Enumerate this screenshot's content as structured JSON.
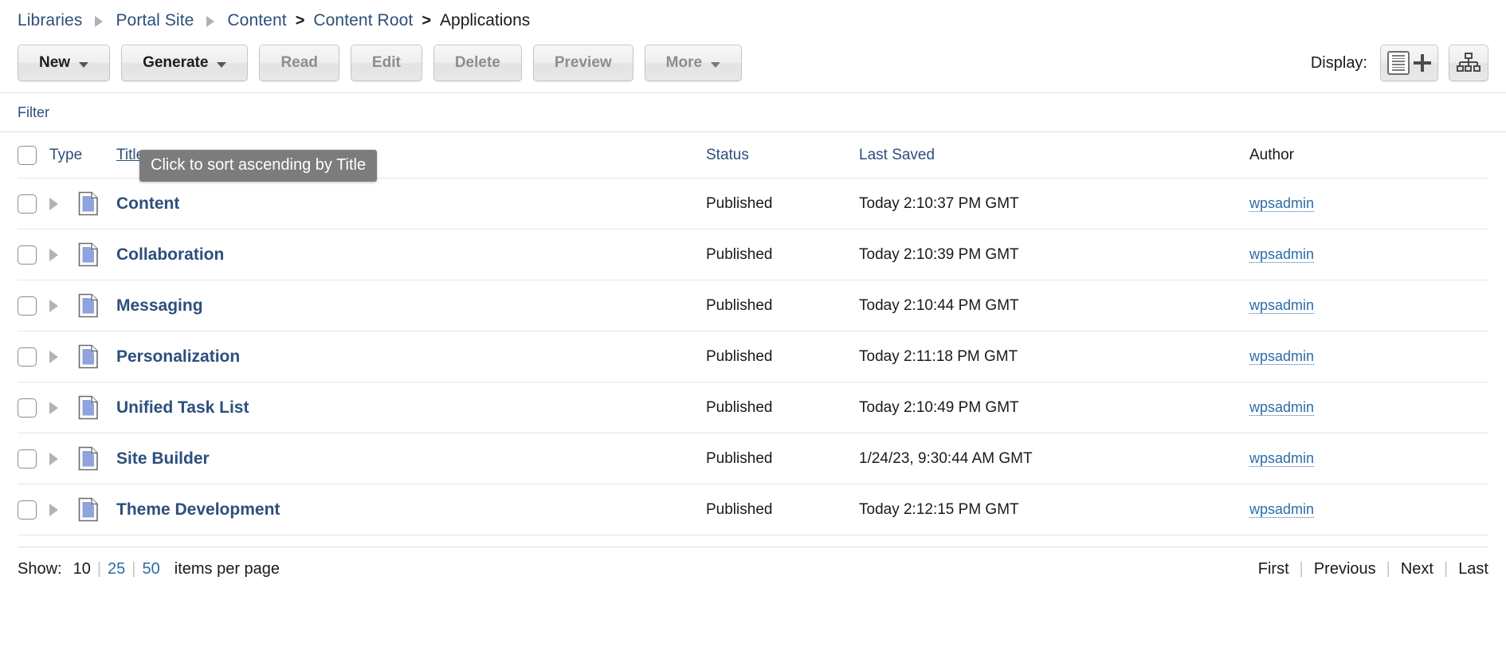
{
  "breadcrumb": {
    "items": [
      {
        "label": "Libraries",
        "type": "link",
        "separator": "arrow"
      },
      {
        "label": "Portal Site",
        "type": "link",
        "separator": "arrow"
      },
      {
        "label": "Content",
        "type": "link",
        "separator": "gt"
      },
      {
        "label": "Content Root",
        "type": "link",
        "separator": "gt"
      },
      {
        "label": "Applications",
        "type": "current",
        "separator": ""
      }
    ],
    "separator_gt": ">"
  },
  "toolbar": {
    "buttons": [
      {
        "label": "New",
        "enabled": true,
        "caret": true
      },
      {
        "label": "Generate",
        "enabled": true,
        "caret": true
      },
      {
        "label": "Read",
        "enabled": false,
        "caret": false
      },
      {
        "label": "Edit",
        "enabled": false,
        "caret": false
      },
      {
        "label": "Delete",
        "enabled": false,
        "caret": false
      },
      {
        "label": "Preview",
        "enabled": false,
        "caret": false
      },
      {
        "label": "More",
        "enabled": false,
        "caret": true
      }
    ],
    "display_label": "Display:",
    "display_options": [
      {
        "icon": "list-plus-icon",
        "selected": true
      },
      {
        "icon": "hierarchy-tree-icon",
        "selected": false
      }
    ]
  },
  "filter": {
    "label": "Filter"
  },
  "tooltip": {
    "text": "Click to sort ascending by Title"
  },
  "table": {
    "columns": [
      {
        "label": "Type",
        "sortable": true,
        "sorted": false
      },
      {
        "label": "Title",
        "sortable": true,
        "sorted": true
      },
      {
        "label": "Status",
        "sortable": true,
        "sorted": false
      },
      {
        "label": "Last Saved",
        "sortable": true,
        "sorted": false
      },
      {
        "label": "Author",
        "sortable": false,
        "sorted": false
      }
    ],
    "rows": [
      {
        "title": "Content",
        "status": "Published",
        "saved": "Today 2:10:37 PM GMT",
        "author": "wpsadmin",
        "icon": "document-icon"
      },
      {
        "title": "Collaboration",
        "status": "Published",
        "saved": "Today 2:10:39 PM GMT",
        "author": "wpsadmin",
        "icon": "document-icon"
      },
      {
        "title": "Messaging",
        "status": "Published",
        "saved": "Today 2:10:44 PM GMT",
        "author": "wpsadmin",
        "icon": "document-icon"
      },
      {
        "title": "Personalization",
        "status": "Published",
        "saved": "Today 2:11:18 PM GMT",
        "author": "wpsadmin",
        "icon": "document-icon"
      },
      {
        "title": "Unified Task List",
        "status": "Published",
        "saved": "Today 2:10:49 PM GMT",
        "author": "wpsadmin",
        "icon": "document-icon"
      },
      {
        "title": "Site Builder",
        "status": "Published",
        "saved": "1/24/23, 9:30:44 AM GMT",
        "author": "wpsadmin",
        "icon": "document-icon"
      },
      {
        "title": "Theme Development",
        "status": "Published",
        "saved": "Today 2:12:15 PM GMT",
        "author": "wpsadmin",
        "icon": "document-icon"
      }
    ]
  },
  "footer": {
    "show_label": "Show:",
    "page_sizes": [
      {
        "label": "10",
        "active": true
      },
      {
        "label": "25",
        "active": false
      },
      {
        "label": "50",
        "active": false
      }
    ],
    "per_page_label": "items per page",
    "separator": "|",
    "nav": [
      {
        "label": "First",
        "enabled": false
      },
      {
        "label": "Previous",
        "enabled": false
      },
      {
        "label": "Next",
        "enabled": false
      },
      {
        "label": "Last",
        "enabled": false
      }
    ]
  },
  "colors": {
    "link": "#2d4f7c",
    "author_link": "#2d6ca8",
    "text": "#1a1a1a",
    "tooltip_bg": "#7c7c7c",
    "doc_page": "#8fa3dd",
    "border": "#e6e6e6"
  }
}
